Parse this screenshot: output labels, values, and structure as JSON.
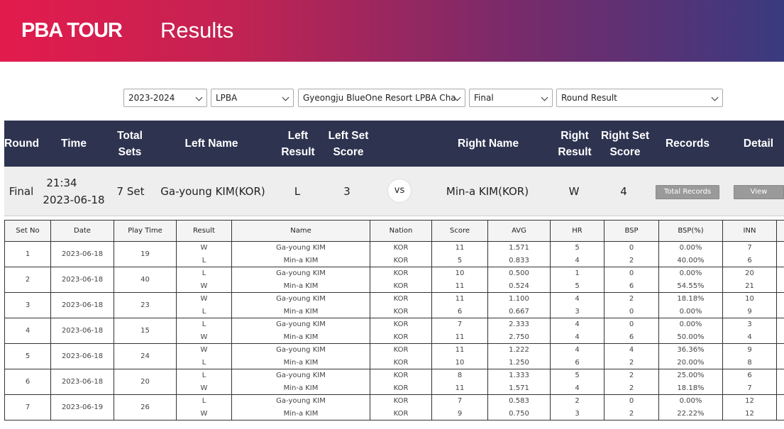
{
  "header": {
    "logo": "PBA TOUR",
    "title": "Results"
  },
  "filters": [
    {
      "name": "season-select",
      "value": "2023-2024"
    },
    {
      "name": "league-select",
      "value": "LPBA"
    },
    {
      "name": "tournament-select",
      "value": "Gyeongju BlueOne Resort LPBA Cha"
    },
    {
      "name": "round-select",
      "value": "Final"
    },
    {
      "name": "view-select",
      "value": "Round Result"
    }
  ],
  "summary_headers": {
    "round": "Round",
    "time": "Time",
    "total_sets_1": "Total",
    "total_sets_2": "Sets",
    "left_name": "Left Name",
    "left_result_1": "Left",
    "left_result_2": "Result",
    "left_set_score_1": "Left Set",
    "left_set_score_2": "Score",
    "right_name": "Right Name",
    "right_result_1": "Right",
    "right_result_2": "Result",
    "right_set_score_1": "Right Set",
    "right_set_score_2": "Score",
    "records": "Records",
    "detail": "Detail"
  },
  "summary": {
    "round": "Final",
    "time": "21:34",
    "date": "2023-06-18",
    "total_sets": "7 Set",
    "left_name": "Ga-young KIM(KOR)",
    "left_result": "L",
    "left_set_score": "3",
    "vs": "vs",
    "right_name": "Min-a KIM(KOR)",
    "right_result": "W",
    "right_set_score": "4",
    "records_button": "Total Records",
    "detail_button": "View"
  },
  "set_headers": [
    "Set No",
    "Date",
    "Play Time",
    "Result",
    "Name",
    "Nation",
    "Score",
    "AVG",
    "HR",
    "BSP",
    "BSP(%)",
    "INN"
  ],
  "sets": [
    {
      "no": "1",
      "date": "2023-06-18",
      "play_time": "19",
      "rows": [
        [
          "W",
          "Ga-young KIM",
          "KOR",
          "11",
          "1.571",
          "5",
          "0",
          "0.00%",
          "7"
        ],
        [
          "L",
          "Min-a KIM",
          "KOR",
          "5",
          "0.833",
          "4",
          "2",
          "40.00%",
          "6"
        ]
      ]
    },
    {
      "no": "2",
      "date": "2023-06-18",
      "play_time": "40",
      "rows": [
        [
          "L",
          "Ga-young KIM",
          "KOR",
          "10",
          "0.500",
          "1",
          "0",
          "0.00%",
          "20"
        ],
        [
          "W",
          "Min-a KIM",
          "KOR",
          "11",
          "0.524",
          "5",
          "6",
          "54.55%",
          "21"
        ]
      ]
    },
    {
      "no": "3",
      "date": "2023-06-18",
      "play_time": "23",
      "rows": [
        [
          "W",
          "Ga-young KIM",
          "KOR",
          "11",
          "1.100",
          "4",
          "2",
          "18.18%",
          "10"
        ],
        [
          "L",
          "Min-a KIM",
          "KOR",
          "6",
          "0.667",
          "3",
          "0",
          "0.00%",
          "9"
        ]
      ]
    },
    {
      "no": "4",
      "date": "2023-06-18",
      "play_time": "15",
      "rows": [
        [
          "L",
          "Ga-young KIM",
          "KOR",
          "7",
          "2.333",
          "4",
          "0",
          "0.00%",
          "3"
        ],
        [
          "W",
          "Min-a KIM",
          "KOR",
          "11",
          "2.750",
          "4",
          "6",
          "50.00%",
          "4"
        ]
      ]
    },
    {
      "no": "5",
      "date": "2023-06-18",
      "play_time": "24",
      "rows": [
        [
          "W",
          "Ga-young KIM",
          "KOR",
          "11",
          "1.222",
          "4",
          "4",
          "36.36%",
          "9"
        ],
        [
          "L",
          "Min-a KIM",
          "KOR",
          "10",
          "1.250",
          "6",
          "2",
          "20.00%",
          "8"
        ]
      ]
    },
    {
      "no": "6",
      "date": "2023-06-18",
      "play_time": "20",
      "rows": [
        [
          "L",
          "Ga-young KIM",
          "KOR",
          "8",
          "1.333",
          "5",
          "2",
          "25.00%",
          "6"
        ],
        [
          "W",
          "Min-a KIM",
          "KOR",
          "11",
          "1.571",
          "4",
          "2",
          "18.18%",
          "7"
        ]
      ]
    },
    {
      "no": "7",
      "date": "2023-06-19",
      "play_time": "26",
      "rows": [
        [
          "L",
          "Ga-young KIM",
          "KOR",
          "7",
          "0.583",
          "2",
          "0",
          "0.00%",
          "12"
        ],
        [
          "W",
          "Min-a KIM",
          "KOR",
          "9",
          "0.750",
          "3",
          "2",
          "22.22%",
          "12"
        ]
      ]
    }
  ]
}
